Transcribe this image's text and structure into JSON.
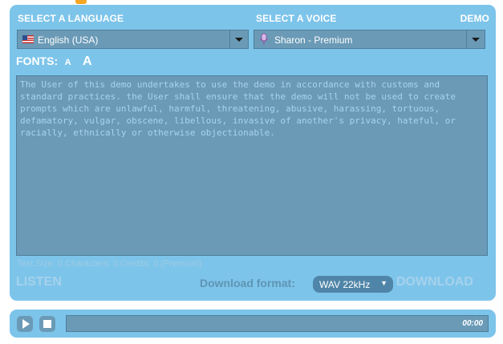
{
  "header": {
    "language_label": "SELECT A LANGUAGE",
    "voice_label": "SELECT A VOICE",
    "demo_label": "DEMO"
  },
  "language_select": {
    "value": "English (USA)",
    "icon": "us-flag-icon"
  },
  "voice_select": {
    "value": "Sharon - Premium",
    "icon": "microphone-icon"
  },
  "fonts": {
    "label": "FONTS:",
    "small": "A",
    "large": "A"
  },
  "text_input": {
    "value": "The User of this demo undertakes to use the demo in accordance with customs and standard practices. the User shall ensure that the demo will not be used to create prompts which are unlawful, harmful, threatening, abusive, harassing, tortuous, defamatory, vulgar, obscene, libellous, invasive of another's privacy, hateful, or racially, ethnically or otherwise objectionable."
  },
  "stats": {
    "text": "Text Size: 0 Characters: 0 Credits: 0 (Premium)"
  },
  "actions": {
    "listen": "LISTEN",
    "download_format_label": "Download format:",
    "download_format_value": "WAV 22kHz",
    "download": "DOWNLOAD"
  },
  "player": {
    "time": "00:00"
  },
  "colors": {
    "panel": "#7dc4ea",
    "field": "#6a9ab6",
    "accent": "#f5a623"
  }
}
